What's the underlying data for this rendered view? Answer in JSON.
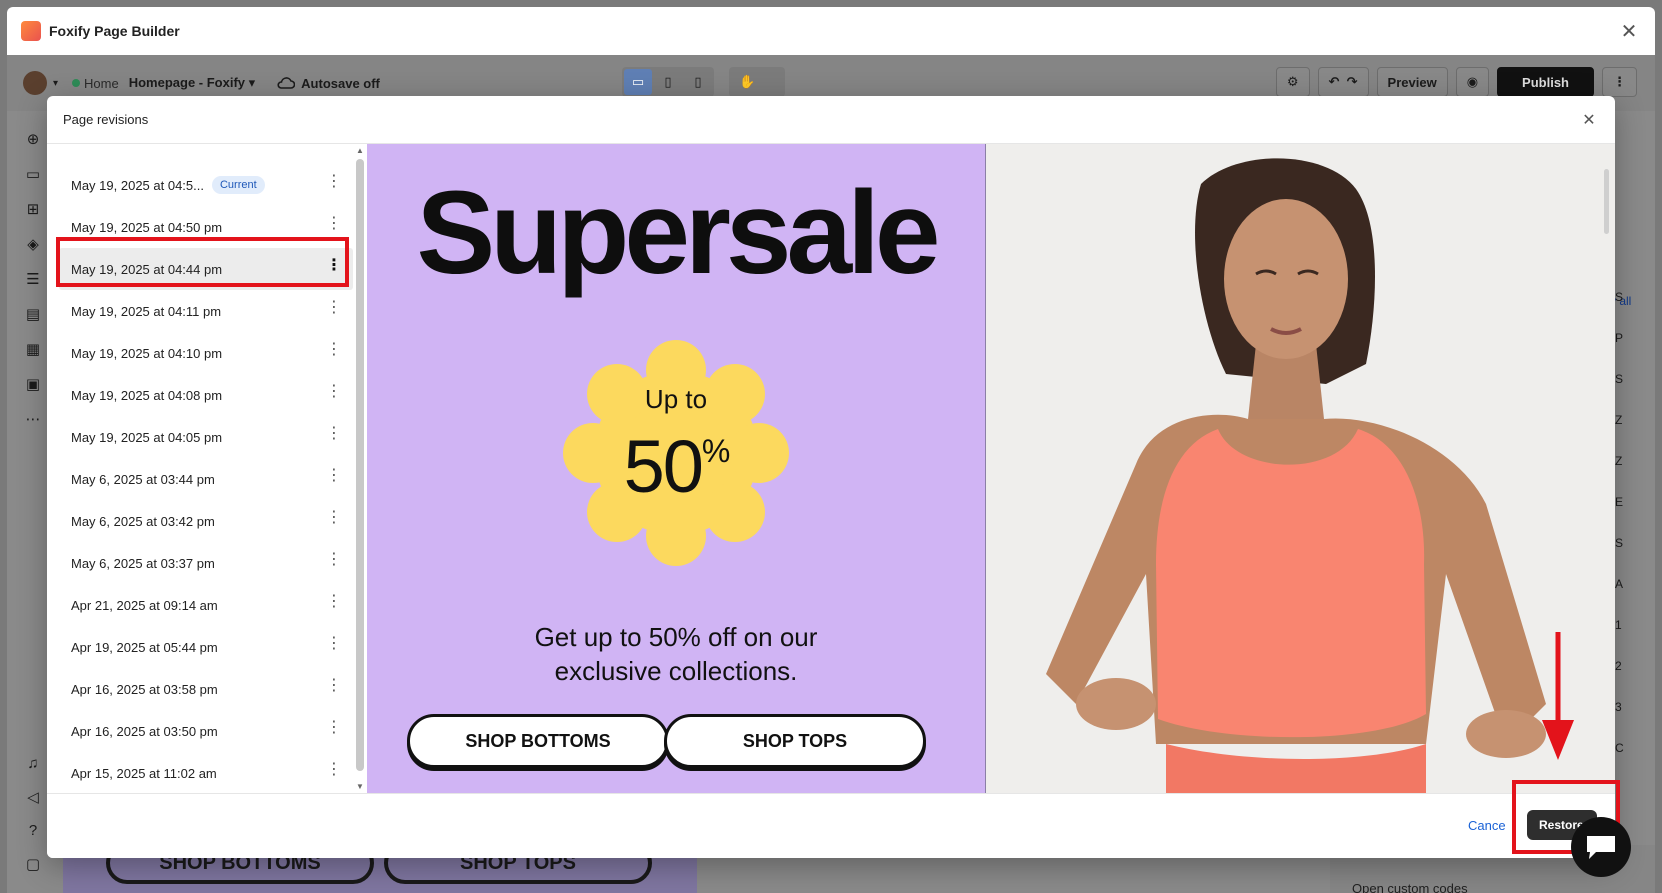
{
  "window": {
    "title": "Foxify Page Builder",
    "close_icon": "close-icon"
  },
  "toolbar": {
    "home_label": "Home",
    "page_name": "Homepage - Foxify",
    "autosave": "Autosave off",
    "preview_label": "Preview",
    "publish_label": "Publish"
  },
  "modal": {
    "title": "Page revisions",
    "current_badge": "Current",
    "revisions": [
      {
        "label": "May 19, 2025 at 04:5..."
      },
      {
        "label": "May 19, 2025 at 04:50 pm"
      },
      {
        "label": "May 19, 2025 at 04:44 pm"
      },
      {
        "label": "May 19, 2025 at 04:11 pm"
      },
      {
        "label": "May 19, 2025 at 04:10 pm"
      },
      {
        "label": "May 19, 2025 at 04:08 pm"
      },
      {
        "label": "May 19, 2025 at 04:05 pm"
      },
      {
        "label": "May 6, 2025 at 03:44 pm"
      },
      {
        "label": "May 6, 2025 at 03:42 pm"
      },
      {
        "label": "May 6, 2025 at 03:37 pm"
      },
      {
        "label": "Apr 21, 2025 at 09:14 am"
      },
      {
        "label": "Apr 19, 2025 at 05:44 pm"
      },
      {
        "label": "Apr 16, 2025 at 03:58 pm"
      },
      {
        "label": "Apr 16, 2025 at 03:50 pm"
      },
      {
        "label": "Apr 15, 2025 at 11:02 am"
      }
    ],
    "selected_index": 2,
    "cancel_label": "Cance",
    "restore_label": "Restore"
  },
  "preview": {
    "headline": "Supersale",
    "badge_top": "Up to",
    "badge_value": "50",
    "badge_unit": "%",
    "description_line1": "Get up to 50% off on our",
    "description_line2": "exclusive collections.",
    "btn_bottoms": "SHOP BOTTOMS",
    "btn_tops": "SHOP TOPS"
  },
  "background": {
    "ghost_bottoms": "SHOP BOTTOMS",
    "ghost_tops": "SHOP TOPS",
    "view_all": "v all",
    "custom_codes": "Open custom codes",
    "side_letters": [
      "S",
      "P",
      "S",
      "Z",
      "Z",
      "E",
      "S",
      "A",
      "1",
      "2",
      "3",
      "C"
    ]
  },
  "colors": {
    "promo_bg": "#d0b4f4",
    "badge_yellow": "#fcd95e",
    "annotation_red": "#e3131b",
    "publish_bg": "#111111",
    "link_blue": "#1a62d6"
  }
}
